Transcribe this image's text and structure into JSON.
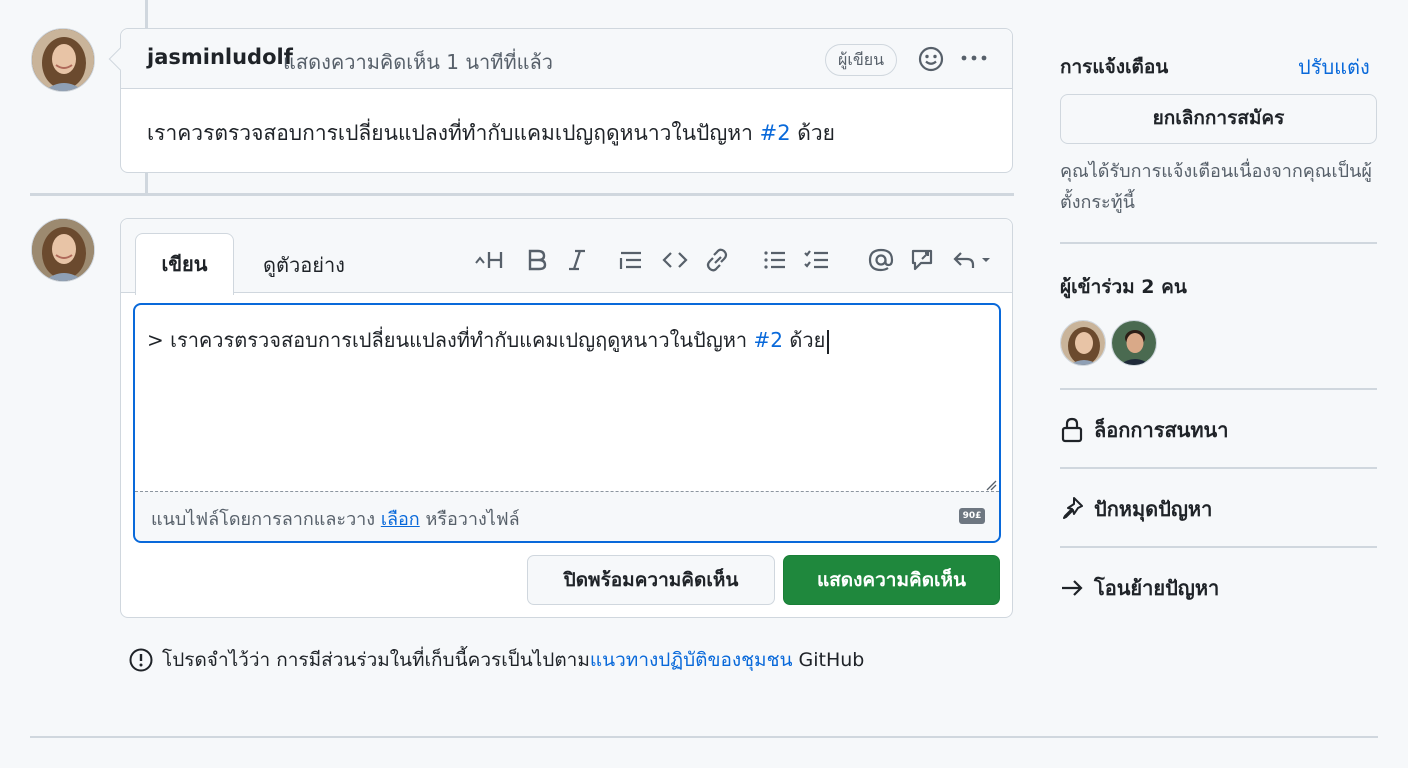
{
  "comment": {
    "author": "jasminludolf",
    "action_text": "แสดงความคิดเห็น 1 นาทีที่แล้ว",
    "badge": "ผู้เขียน",
    "body_text": "เราควรตรวจสอบการเปลี่ยนแปลงที่ทำกับแคมเปญฤดูหนาวในปัญหา",
    "body_ref": "#2",
    "body_suffix": "ด้วย",
    "icons": [
      "smiley-icon",
      "kebab-horizontal-icon"
    ]
  },
  "editor": {
    "tabs": [
      {
        "label": "เขียน",
        "selected": true
      },
      {
        "label": "ดูตัวอย่าง",
        "selected": false
      }
    ],
    "toolbar_icons": [
      "heading-icon",
      "bold-icon",
      "italic-icon",
      "quote-icon",
      "code-icon",
      "link-icon",
      "unordered-list-icon",
      "task-list-icon",
      "mention-icon",
      "reference-icon",
      "reply-icon"
    ],
    "textarea_prefix": "> เราควรตรวจสอบการเปลี่ยนแปลงที่ทำกับแคมเปญฤดูหนาวในปัญหา",
    "textarea_ref": "#2",
    "textarea_suffix": "ด้วย",
    "attach_text": "แนบไฟล์โดยการลากและวาง",
    "attach_link": "เลือก",
    "attach_suffix": "หรือวางไฟล์",
    "markdown_icon_label": "90£",
    "close_button": "ปิดพร้อมความคิดเห็น",
    "comment_button": "แสดงความคิดเห็น",
    "accent_color": "#0969da",
    "primary_color": "#1f883d"
  },
  "note": {
    "text": "โปรดจำไว้ว่า การมีส่วนร่วมในที่เก็บนี้ควรเป็นไปตาม",
    "link": "แนวทางปฏิบัติของชุมชน",
    "suffix": "GitHub"
  },
  "sidebar": {
    "notifications_title": "การแจ้งเตือน",
    "customize_link": "ปรับแต่ง",
    "unsubscribe_button": "ยกเลิกการสมัคร",
    "notification_reason": "คุณได้รับการแจ้งเตือนเนื่องจากคุณเป็นผู้ตั้งกระทู้นี้",
    "participants_title": "ผู้เข้าร่วม 2 คน",
    "lock_action": "ล็อกการสนทนา",
    "pin_action": "ปักหมุดปัญหา",
    "transfer_action": "โอนย้ายปัญหา"
  }
}
